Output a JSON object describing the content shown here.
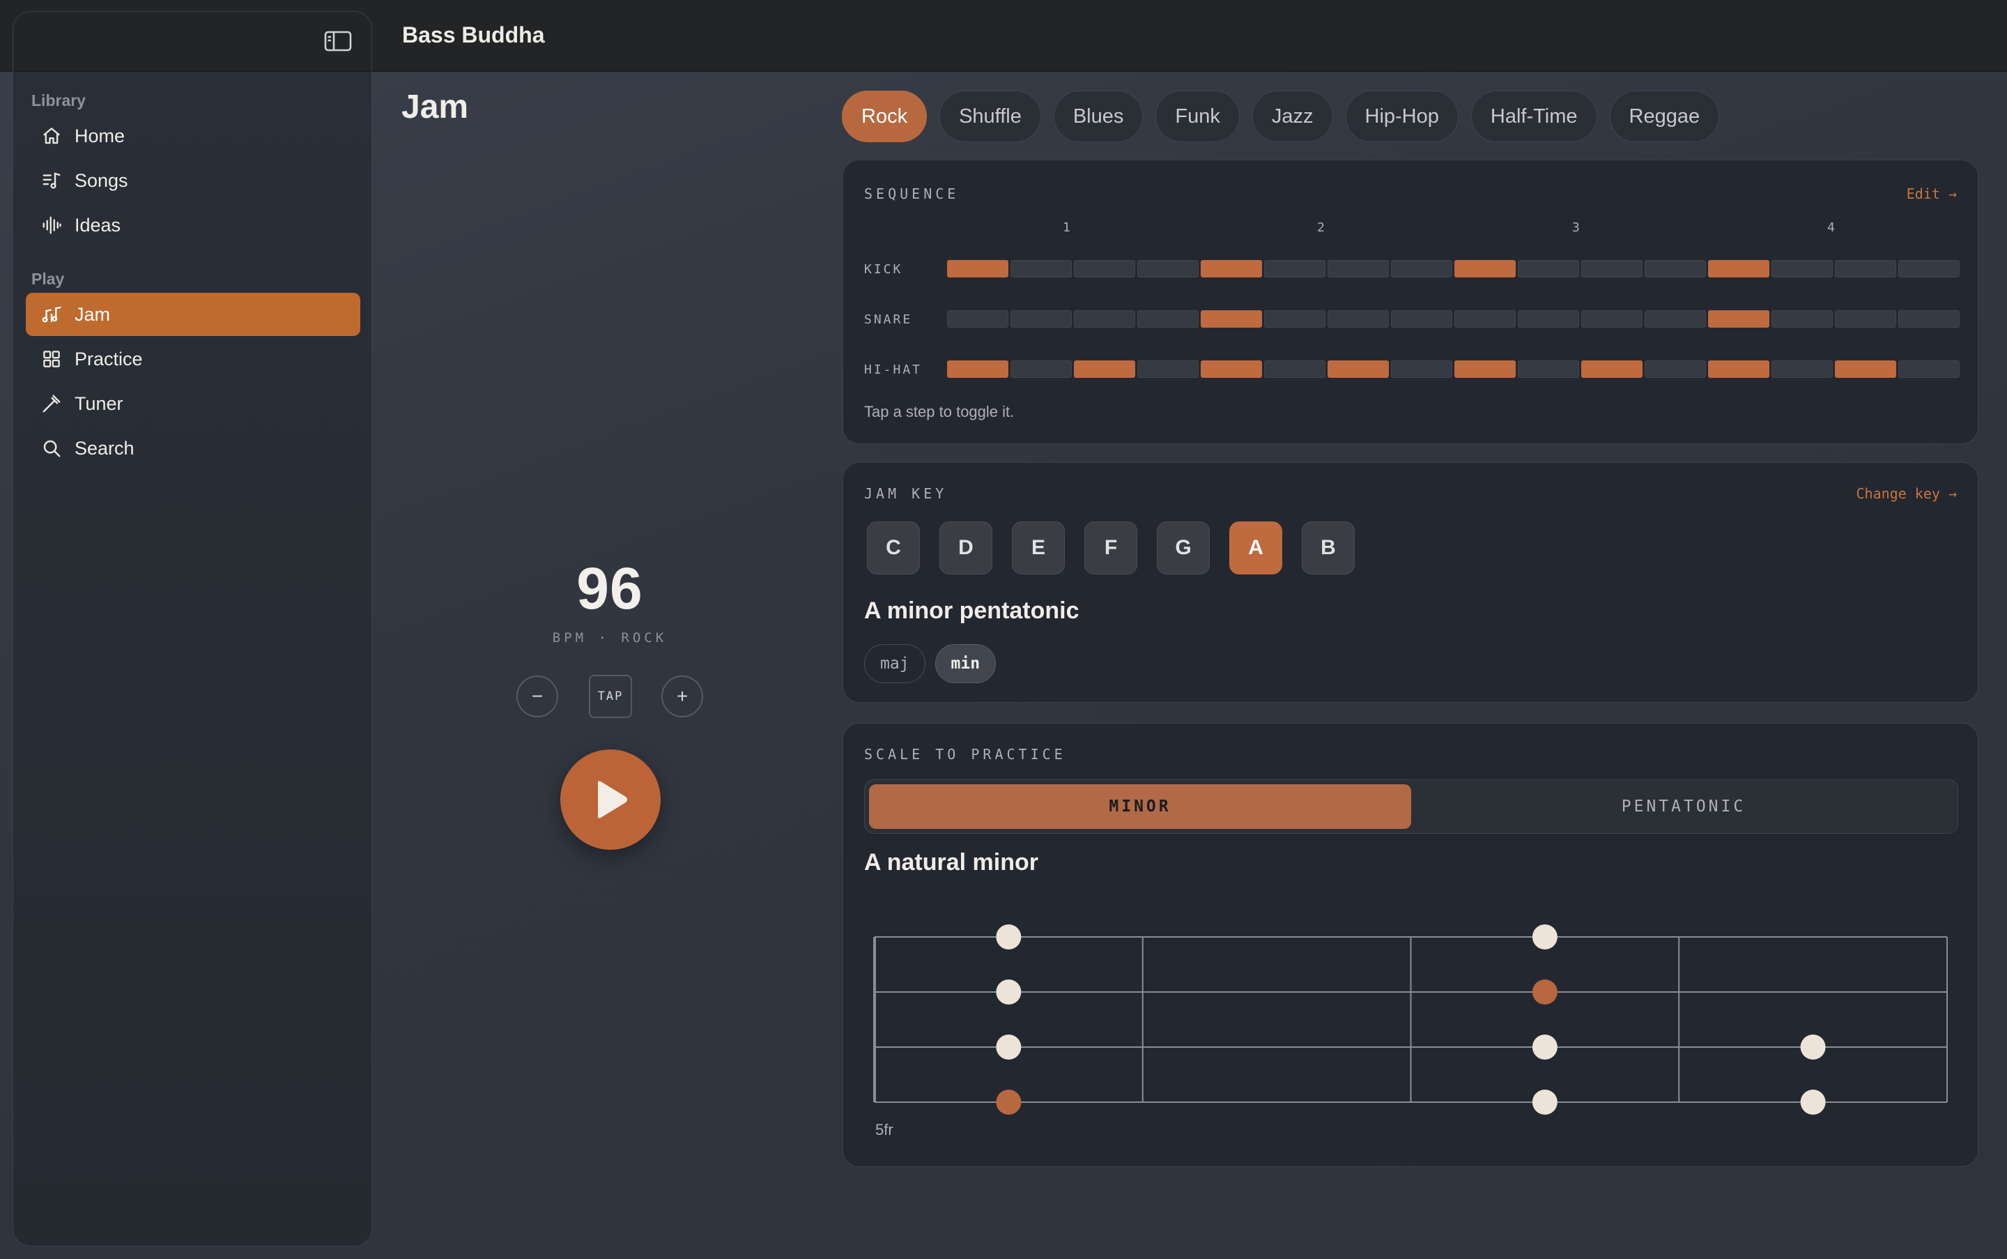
{
  "app": {
    "title": "Bass Buddha"
  },
  "sidebar": {
    "sections": [
      {
        "label": "Library",
        "items": [
          {
            "label": "Home",
            "icon": "home-icon"
          },
          {
            "label": "Songs",
            "icon": "songs-icon"
          },
          {
            "label": "Ideas",
            "icon": "waveform-icon"
          }
        ]
      },
      {
        "label": "Play",
        "items": [
          {
            "label": "Jam",
            "icon": "music-notes-icon",
            "active": true
          },
          {
            "label": "Practice",
            "icon": "grid-icon"
          },
          {
            "label": "Tuner",
            "icon": "tuning-fork-icon"
          },
          {
            "label": "Search",
            "icon": "search-icon"
          }
        ]
      }
    ]
  },
  "page": {
    "title": "Jam"
  },
  "genres": {
    "items": [
      "Rock",
      "Shuffle",
      "Blues",
      "Funk",
      "Jazz",
      "Hip-Hop",
      "Half-Time",
      "Reggae"
    ],
    "selected": "Rock"
  },
  "tempo": {
    "bpm": "96",
    "subtitle": "BPM · ROCK",
    "minus": "−",
    "tap": "TAP",
    "plus": "+"
  },
  "sequence": {
    "label": "SEQUENCE",
    "edit": "Edit →",
    "beats": [
      "1",
      "2",
      "3",
      "4"
    ],
    "rows": [
      {
        "name": "KICK",
        "steps": [
          1,
          0,
          0,
          0,
          1,
          0,
          0,
          0,
          1,
          0,
          0,
          0,
          1,
          0,
          0,
          0
        ]
      },
      {
        "name": "SNARE",
        "steps": [
          0,
          0,
          0,
          0,
          1,
          0,
          0,
          0,
          0,
          0,
          0,
          0,
          1,
          0,
          0,
          0
        ]
      },
      {
        "name": "HI-HAT",
        "steps": [
          1,
          0,
          1,
          0,
          1,
          0,
          1,
          0,
          1,
          0,
          1,
          0,
          1,
          0,
          1,
          0
        ]
      }
    ],
    "hint": "Tap a step to toggle it."
  },
  "jam_key": {
    "label": "JAM KEY",
    "change": "Change key →",
    "keys": [
      "C",
      "D",
      "E",
      "F",
      "G",
      "A",
      "B"
    ],
    "selected": "A",
    "scale": "A minor pentatonic",
    "modes": [
      "maj",
      "min"
    ],
    "selected_mode": "min"
  },
  "scale_practice": {
    "label": "SCALE TO PRACTICE",
    "options": [
      "MINOR",
      "PENTATONIC"
    ],
    "selected": "MINOR",
    "scale_name": "A natural minor",
    "start_fret_label": "5fr",
    "frets": 4,
    "notes": [
      {
        "string": 1,
        "fret": 1,
        "root": false
      },
      {
        "string": 1,
        "fret": 3,
        "root": false
      },
      {
        "string": 2,
        "fret": 1,
        "root": false
      },
      {
        "string": 2,
        "fret": 3,
        "root": true
      },
      {
        "string": 3,
        "fret": 1,
        "root": false
      },
      {
        "string": 3,
        "fret": 3,
        "root": false
      },
      {
        "string": 3,
        "fret": 4,
        "root": false
      },
      {
        "string": 4,
        "fret": 1,
        "root": true
      },
      {
        "string": 4,
        "fret": 3,
        "root": false
      },
      {
        "string": 4,
        "fret": 4,
        "root": false
      }
    ]
  },
  "colors": {
    "accent": "#bf6a2f",
    "step_on": "#c06a3f",
    "note": "#ece4d8",
    "root_note": "#b8683f"
  }
}
